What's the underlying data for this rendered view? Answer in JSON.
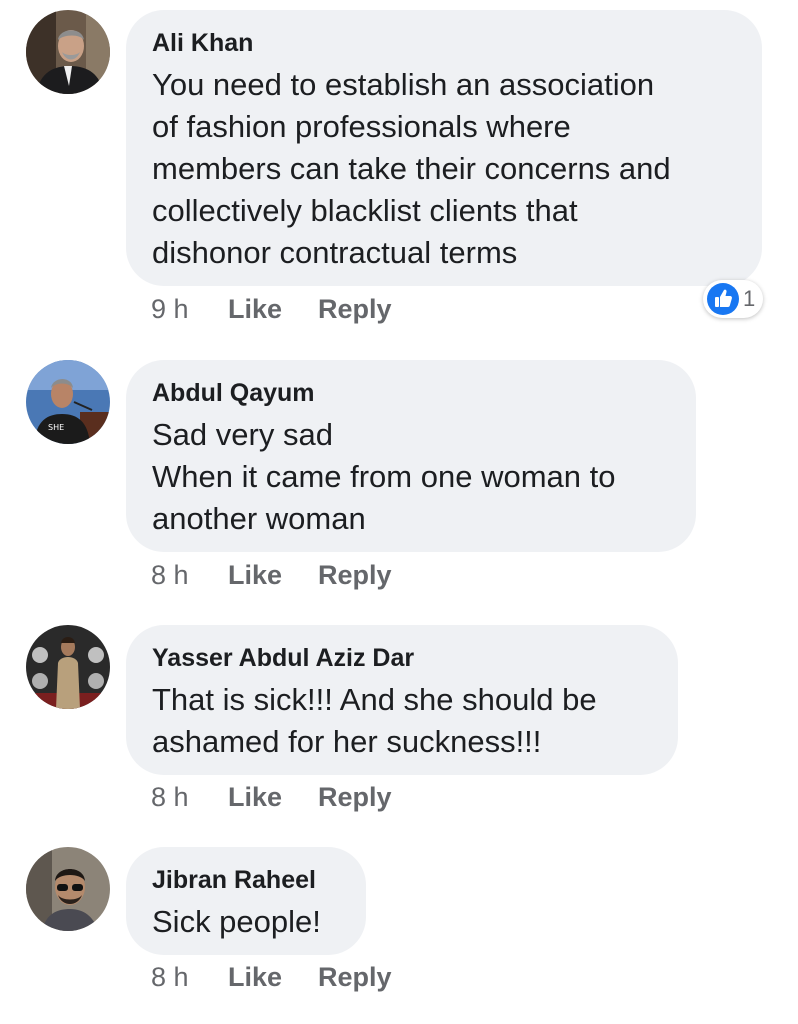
{
  "comments": [
    {
      "author": "Ali Khan",
      "text": "You need to establish an association\nof fashion professionals where\nmembers can take their concerns and\ncollectively blacklist clients that\ndishonor contractual terms",
      "time": "9 h",
      "like_label": "Like",
      "reply_label": "Reply",
      "reactions": {
        "icon": "like-icon",
        "count": "1"
      }
    },
    {
      "author": "Abdul Qayum",
      "text": "Sad very sad\nWhen it came from one woman to\nanother woman",
      "time": "8 h",
      "like_label": "Like",
      "reply_label": "Reply"
    },
    {
      "author": "Yasser Abdul Aziz Dar",
      "text": "That is sick!!! And she should be\nashamed for her suckness!!!",
      "time": "8 h",
      "like_label": "Like",
      "reply_label": "Reply"
    },
    {
      "author": "Jibran Raheel",
      "text": "Sick people!",
      "time": "8 h",
      "like_label": "Like",
      "reply_label": "Reply"
    }
  ],
  "colors": {
    "bubble_background": "#eff1f4",
    "author_text": "#1c1e21",
    "meta_text": "#65676b",
    "like_reaction": "#1877f2"
  }
}
